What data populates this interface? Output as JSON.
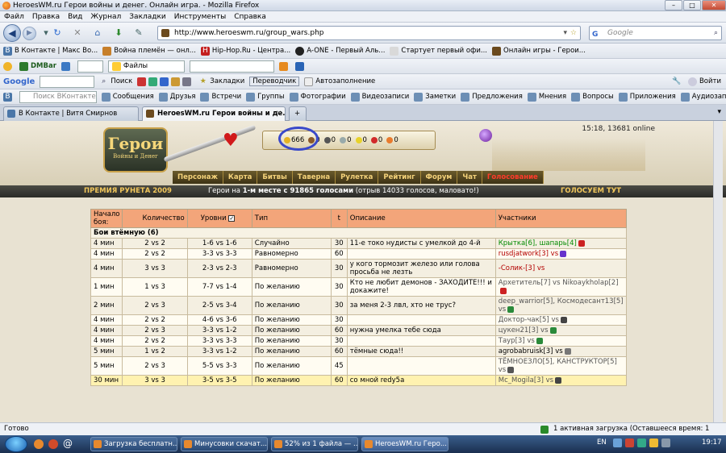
{
  "window": {
    "title": "HeroesWM.ru Герои войны и денег. Онлайн игра. - Mozilla Firefox"
  },
  "menu": [
    "Файл",
    "Правка",
    "Вид",
    "Журнал",
    "Закладки",
    "Инструменты",
    "Справка"
  ],
  "nav": {
    "url": "http://www.heroeswm.ru/group_wars.php",
    "search_placeholder": "Google"
  },
  "bookmarks": [
    "В Контакте | Макс Во...",
    "Война племён — онл...",
    "Hip-Hop.Ru - Центра...",
    "A-ONE - Первый Аль...",
    "Стартует первый офи...",
    "Онлайн игры - Герои..."
  ],
  "toolbar2": {
    "dmbar": "DMBar",
    "files": "Файлы"
  },
  "google_bar": {
    "brand": "Google",
    "search": "Поиск",
    "bookmarks": "Закладки",
    "translator": "Переводчик",
    "autofill": "Автозаполнение",
    "login": "Войти"
  },
  "vk_bar": {
    "search_placeholder": "Поиск ВКонтакте",
    "items": [
      "Сообщения",
      "Друзья",
      "Встречи",
      "Группы",
      "Фотографии",
      "Видеозаписи",
      "Заметки",
      "Предложения",
      "Мнения",
      "Вопросы",
      "Приложения",
      "Аудиозаписи"
    ]
  },
  "tabs": [
    {
      "label": "В Контакте | Витя Смирнов"
    },
    {
      "label": "HeroesWM.ru Герои войны и де..."
    }
  ],
  "game": {
    "logo_line1": "Герои",
    "logo_line2": "Войны и Денег",
    "time_online": "15:18, 13681 online",
    "resources": [
      "666",
      "0",
      "0",
      "0",
      "0",
      "0",
      "0"
    ],
    "nav": [
      "Персонаж",
      "Карта",
      "Битвы",
      "Таверна",
      "Рулетка",
      "Рейтинг",
      "Форум",
      "Чат",
      "Голосование"
    ],
    "banner_left": "ПРЕМИЯ РУНЕТА 2009",
    "banner_mid_a": "Герои на ",
    "banner_mid_b": "1-м месте с 91865 голосами",
    "banner_mid_c": " (отрыв 14033 голосов, маловато!)",
    "banner_right": "ГОЛОСУЕМ ТУТ"
  },
  "table": {
    "headers": [
      "Начало боя:",
      "Количество",
      "Уровни",
      "Тип",
      "t",
      "Описание",
      "Участники"
    ],
    "section": "Бои втёмную (6)",
    "rows": [
      [
        "4 мин",
        "2 vs 2",
        "1-6 vs 1-6",
        "Случайно",
        "30",
        "11-е токо нудисты с умелкой до 4-й",
        "Крытка[6], шапарь[4]"
      ],
      [
        "4 мин",
        "2 vs 2",
        "3-3 vs 3-3",
        "Равномерно",
        "60",
        "",
        "rusdjatwork[3] vs"
      ],
      [
        "4 мин",
        "3 vs 3",
        "2-3 vs 2-3",
        "Равномерно",
        "30",
        "у кого тормозит железо или голова просьба не лезть",
        "-Солик-[3] vs"
      ],
      [
        "1 мин",
        "1 vs 3",
        "7-7 vs 1-4",
        "По желанию",
        "30",
        "Кто не любит демонов - ЗАХОДИТЕ!!! и докажите!",
        "Архетитель[7] vs Nikoaykholap[2]"
      ],
      [
        "2 мин",
        "2 vs 3",
        "2-5 vs 3-4",
        "По желанию",
        "30",
        "за меня 2-3 лвл, хто не трус?",
        "deep_warrior[5], Космодесант13[5] vs"
      ],
      [
        "4 мин",
        "2 vs 2",
        "4-6 vs 3-6",
        "По желанию",
        "30",
        "",
        "Доктор-чак[5] vs"
      ],
      [
        "4 мин",
        "2 vs 3",
        "3-3 vs 1-2",
        "По желанию",
        "60",
        "нужна умелка тебе сюда",
        "цукен21[3] vs"
      ],
      [
        "4 мин",
        "2 vs 2",
        "3-3 vs 3-3",
        "По желанию",
        "30",
        "",
        "Таур[3] vs"
      ],
      [
        "5 мин",
        "1 vs 2",
        "3-3 vs 1-2",
        "По желанию",
        "60",
        "тёмные сюда!!",
        "agrobabruisk[3] vs"
      ],
      [
        "5 мин",
        "2 vs 3",
        "5-5 vs 3-3",
        "По желанию",
        "45",
        "",
        "ТЁМНОЕЗЛО[5], КАНСТРУКТОР[5] vs"
      ],
      [
        "30 мин",
        "3 vs 3",
        "3-5 vs 3-5",
        "По желанию",
        "60",
        "со мной redy5a",
        "Mc_Mogila[3] vs"
      ]
    ]
  },
  "status": {
    "left": "Готово",
    "right": "1 активная загрузка (Оставшееся время: 1 минута)"
  },
  "taskbar": {
    "items": [
      "Загрузка бесплатн...",
      "Минусовки скачат...",
      "52% из 1 файла — ...",
      "HeroesWM.ru Геро..."
    ],
    "lang": "EN",
    "time": "19:17"
  },
  "colors": {
    "table_header": "#f3a57a",
    "nav_text": "#f4d27a",
    "vote_link": "#ff3c2a",
    "highlight_circle": "#3a49c9"
  }
}
